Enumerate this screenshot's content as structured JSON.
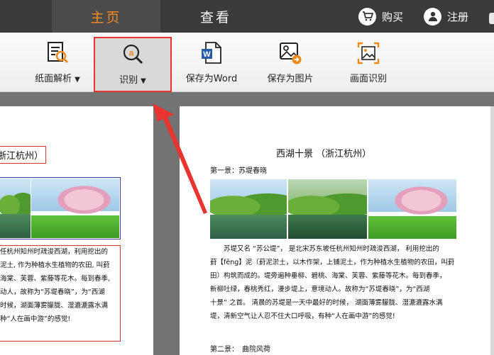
{
  "topbar": {
    "tabs": [
      {
        "label": "主页",
        "active": true
      },
      {
        "label": "查看",
        "active": false
      }
    ],
    "buy_label": "购买",
    "register_label": "注册"
  },
  "toolbar": {
    "items": [
      {
        "label": "纸面解析",
        "icon": "doc-search-icon",
        "has_dropdown": true
      },
      {
        "label": "识别",
        "icon": "ocr-recognize-icon",
        "has_dropdown": true,
        "highlighted": true
      },
      {
        "label": "保存为Word",
        "icon": "word-doc-icon",
        "has_dropdown": false
      },
      {
        "label": "保存为图片",
        "icon": "save-image-icon",
        "has_dropdown": false
      },
      {
        "label": "画面识别",
        "icon": "screen-recognize-icon",
        "has_dropdown": false
      }
    ]
  },
  "left_page": {
    "title_fragment": "浙江杭州）",
    "lines": [
      "任杭州知州时疏浚西湖，利用挖出的",
      "泥土, 作为种植水生植物的农田, 叫葑",
      "海棠、芙蓉、紫藤等花木。每到春季,",
      "动人，故称为“苏堤春晓”，为“西湖",
      "时候，湖面薄雾朦胧、湿漉漉露水满",
      "种“人在画中游”的感觉!"
    ]
  },
  "right_page": {
    "title": "西湖十景 （浙江杭州）",
    "scene1": "第一景：苏堤春晓",
    "lines": [
      "苏堤又名 “苏公堤”， 是北宋苏东坡任杭州知州时疏浚西湖， 利用挖出的",
      "葑【fēng】泥（葑泥淤土，以木作架，上铺泥土，作为种植水生植物的农田，叫葑",
      "田）构筑而成的。堤旁遍种垂柳、碧桃、海棠、芙蓉、紫藤等花木。每到春季，",
      "新柳吐绿，春桃秀红，漫步堤上，意境动人。故称为“苏堤春晓”，为“西湖",
      "十景” 之首。 清晨的苏堤是一天中最好的时候， 湖面薄雾朦胧、湿漉漉露水满",
      "堤，清新空气让人忍不住大口呼吸，有种“人在画中游”的感觉!"
    ],
    "scene2": "第二景：　曲院风荷"
  },
  "colors": {
    "accent_orange": "#ff8a1e",
    "highlight_red": "#e8352f",
    "topbar_bg": "#3a3a3a"
  }
}
